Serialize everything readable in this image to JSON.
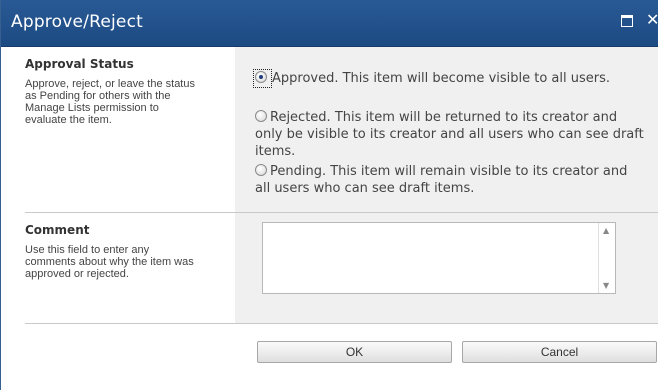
{
  "dialog": {
    "title": "Approve/Reject"
  },
  "approval_status": {
    "title": "Approval Status",
    "description": "Approve, reject, or leave the status as Pending for others with the Manage Lists permission to evaluate the item.",
    "options": [
      {
        "label": "Approved. This item will become visible to all users.",
        "checked": true
      },
      {
        "label": "Rejected. This item will be returned to its creator and only be visible to its creator and all users who can see draft items.",
        "checked": false
      },
      {
        "label": "Pending. This item will remain visible to its creator and all users who can see draft items.",
        "checked": false
      }
    ]
  },
  "comment": {
    "title": "Comment",
    "description": "Use this field to enter any comments about why the item was approved or rejected.",
    "value": ""
  },
  "buttons": {
    "ok_label": "OK",
    "cancel_label": "Cancel"
  }
}
